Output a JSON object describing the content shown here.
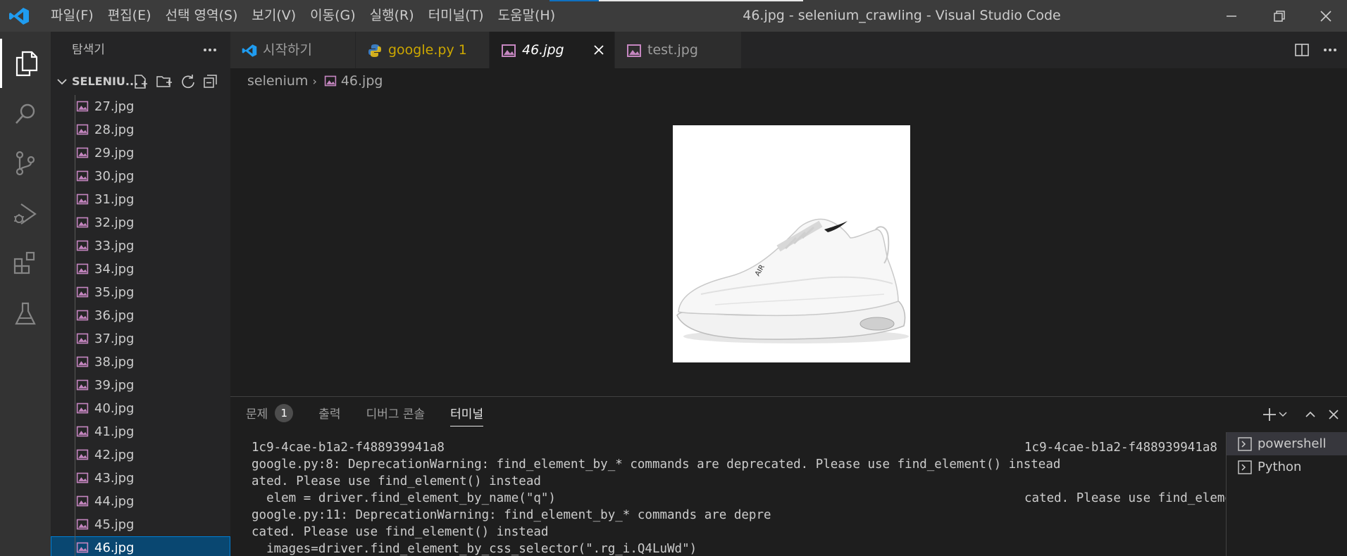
{
  "titlebar": {
    "menu": [
      "파일(F)",
      "편집(E)",
      "선택 영역(S)",
      "보기(V)",
      "이동(G)",
      "실행(R)",
      "터미널(T)",
      "도움말(H)"
    ],
    "window_title": "46.jpg - selenium_crawling - Visual Studio Code"
  },
  "sidebar": {
    "title": "탐색기",
    "folder_name": "SELENIU...",
    "files": [
      "27.jpg",
      "28.jpg",
      "29.jpg",
      "30.jpg",
      "31.jpg",
      "32.jpg",
      "33.jpg",
      "34.jpg",
      "35.jpg",
      "36.jpg",
      "37.jpg",
      "38.jpg",
      "39.jpg",
      "40.jpg",
      "41.jpg",
      "42.jpg",
      "43.jpg",
      "44.jpg",
      "45.jpg",
      "46.jpg"
    ],
    "selected_file": "46.jpg"
  },
  "tabs": [
    {
      "label": "시작하기",
      "icon": "vscode-icon"
    },
    {
      "label": "google.py 1",
      "icon": "python-icon",
      "color": "#cca700"
    },
    {
      "label": "46.jpg",
      "icon": "image-icon",
      "active": true
    },
    {
      "label": "test.jpg",
      "icon": "image-icon"
    }
  ],
  "breadcrumb": {
    "folder": "selenium",
    "file": "46.jpg"
  },
  "panel": {
    "tabs": {
      "problems": "문제",
      "problems_count": "1",
      "output": "출력",
      "debug_console": "디버그 콘솔",
      "terminal": "터미널"
    },
    "terminal_left": [
      "1c9-4cae-b1a2-f488939941a8",
      "google.py:8: DeprecationWarning: find_element_by_* commands are deprecated. Please use find_element() instead",
      "ated. Please use find_element() instead",
      "  elem = driver.find_element_by_name(\"q\")",
      "google.py:11: DeprecationWarning: find_element_by_* commands are depre",
      "cated. Please use find_element() instead",
      "  images=driver.find_element_by_css_selector(\".rg_i.Q4LuWd\")"
    ],
    "terminal_right": [
      "1c9-4cae-b1a2-f488939941a8",
      "",
      "",
      "cated. Please use find_element() instead"
    ],
    "terminals": [
      "powershell",
      "Python"
    ]
  },
  "colors": {
    "accent": "#007fd4",
    "selection": "#094771",
    "image_icon": "#c586c0",
    "python_tab": "#cca700"
  }
}
